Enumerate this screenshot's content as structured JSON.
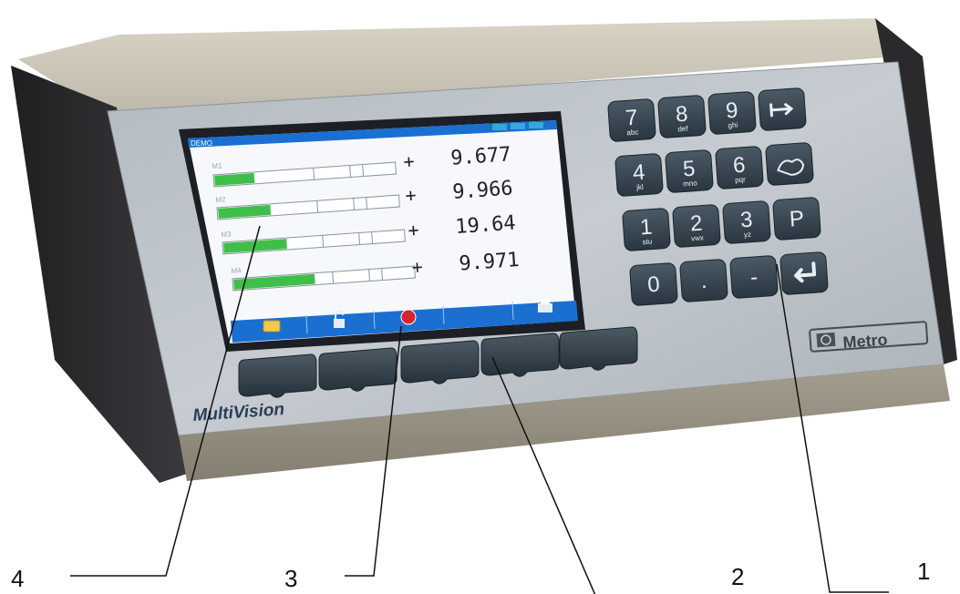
{
  "device": {
    "brand_left": "MultiVision",
    "brand_right": "Metro"
  },
  "screen": {
    "title": "DEMO",
    "rows": [
      {
        "label": "M1",
        "sign": "+",
        "value": "9.677",
        "fill": 0.22
      },
      {
        "label": "M2",
        "sign": "+",
        "value": "9.966",
        "fill": 0.29
      },
      {
        "label": "M3",
        "sign": "+",
        "value": "19.64",
        "fill": 0.35
      },
      {
        "label": "M4",
        "sign": "+",
        "value": "9.971",
        "fill": 0.45
      }
    ],
    "softkey_icons": [
      "folder-icon",
      "unlock-icon",
      "stop-icon",
      "",
      "printer-icon"
    ],
    "accent_color": "#1a6fd1",
    "bar_color": "#3fbf4a"
  },
  "keypad": {
    "keys": [
      {
        "main": "7",
        "sub": "abc"
      },
      {
        "main": "8",
        "sub": "def"
      },
      {
        "main": "9",
        "sub": "ghi"
      },
      {
        "main": "",
        "sub": "",
        "icon": "tab-arrow-icon"
      },
      {
        "main": "4",
        "sub": "jkl"
      },
      {
        "main": "5",
        "sub": "mno"
      },
      {
        "main": "6",
        "sub": "pqr"
      },
      {
        "main": "",
        "sub": "",
        "icon": "hand-icon"
      },
      {
        "main": "1",
        "sub": "stu"
      },
      {
        "main": "2",
        "sub": "vwx"
      },
      {
        "main": "3",
        "sub": "yz"
      },
      {
        "main": "P",
        "sub": ""
      },
      {
        "main": "0",
        "sub": ""
      },
      {
        "main": ".",
        "sub": ""
      },
      {
        "main": "-",
        "sub": ""
      },
      {
        "main": "",
        "sub": "",
        "icon": "enter-icon"
      }
    ]
  },
  "callouts": [
    "4",
    "3",
    "2",
    "1"
  ]
}
